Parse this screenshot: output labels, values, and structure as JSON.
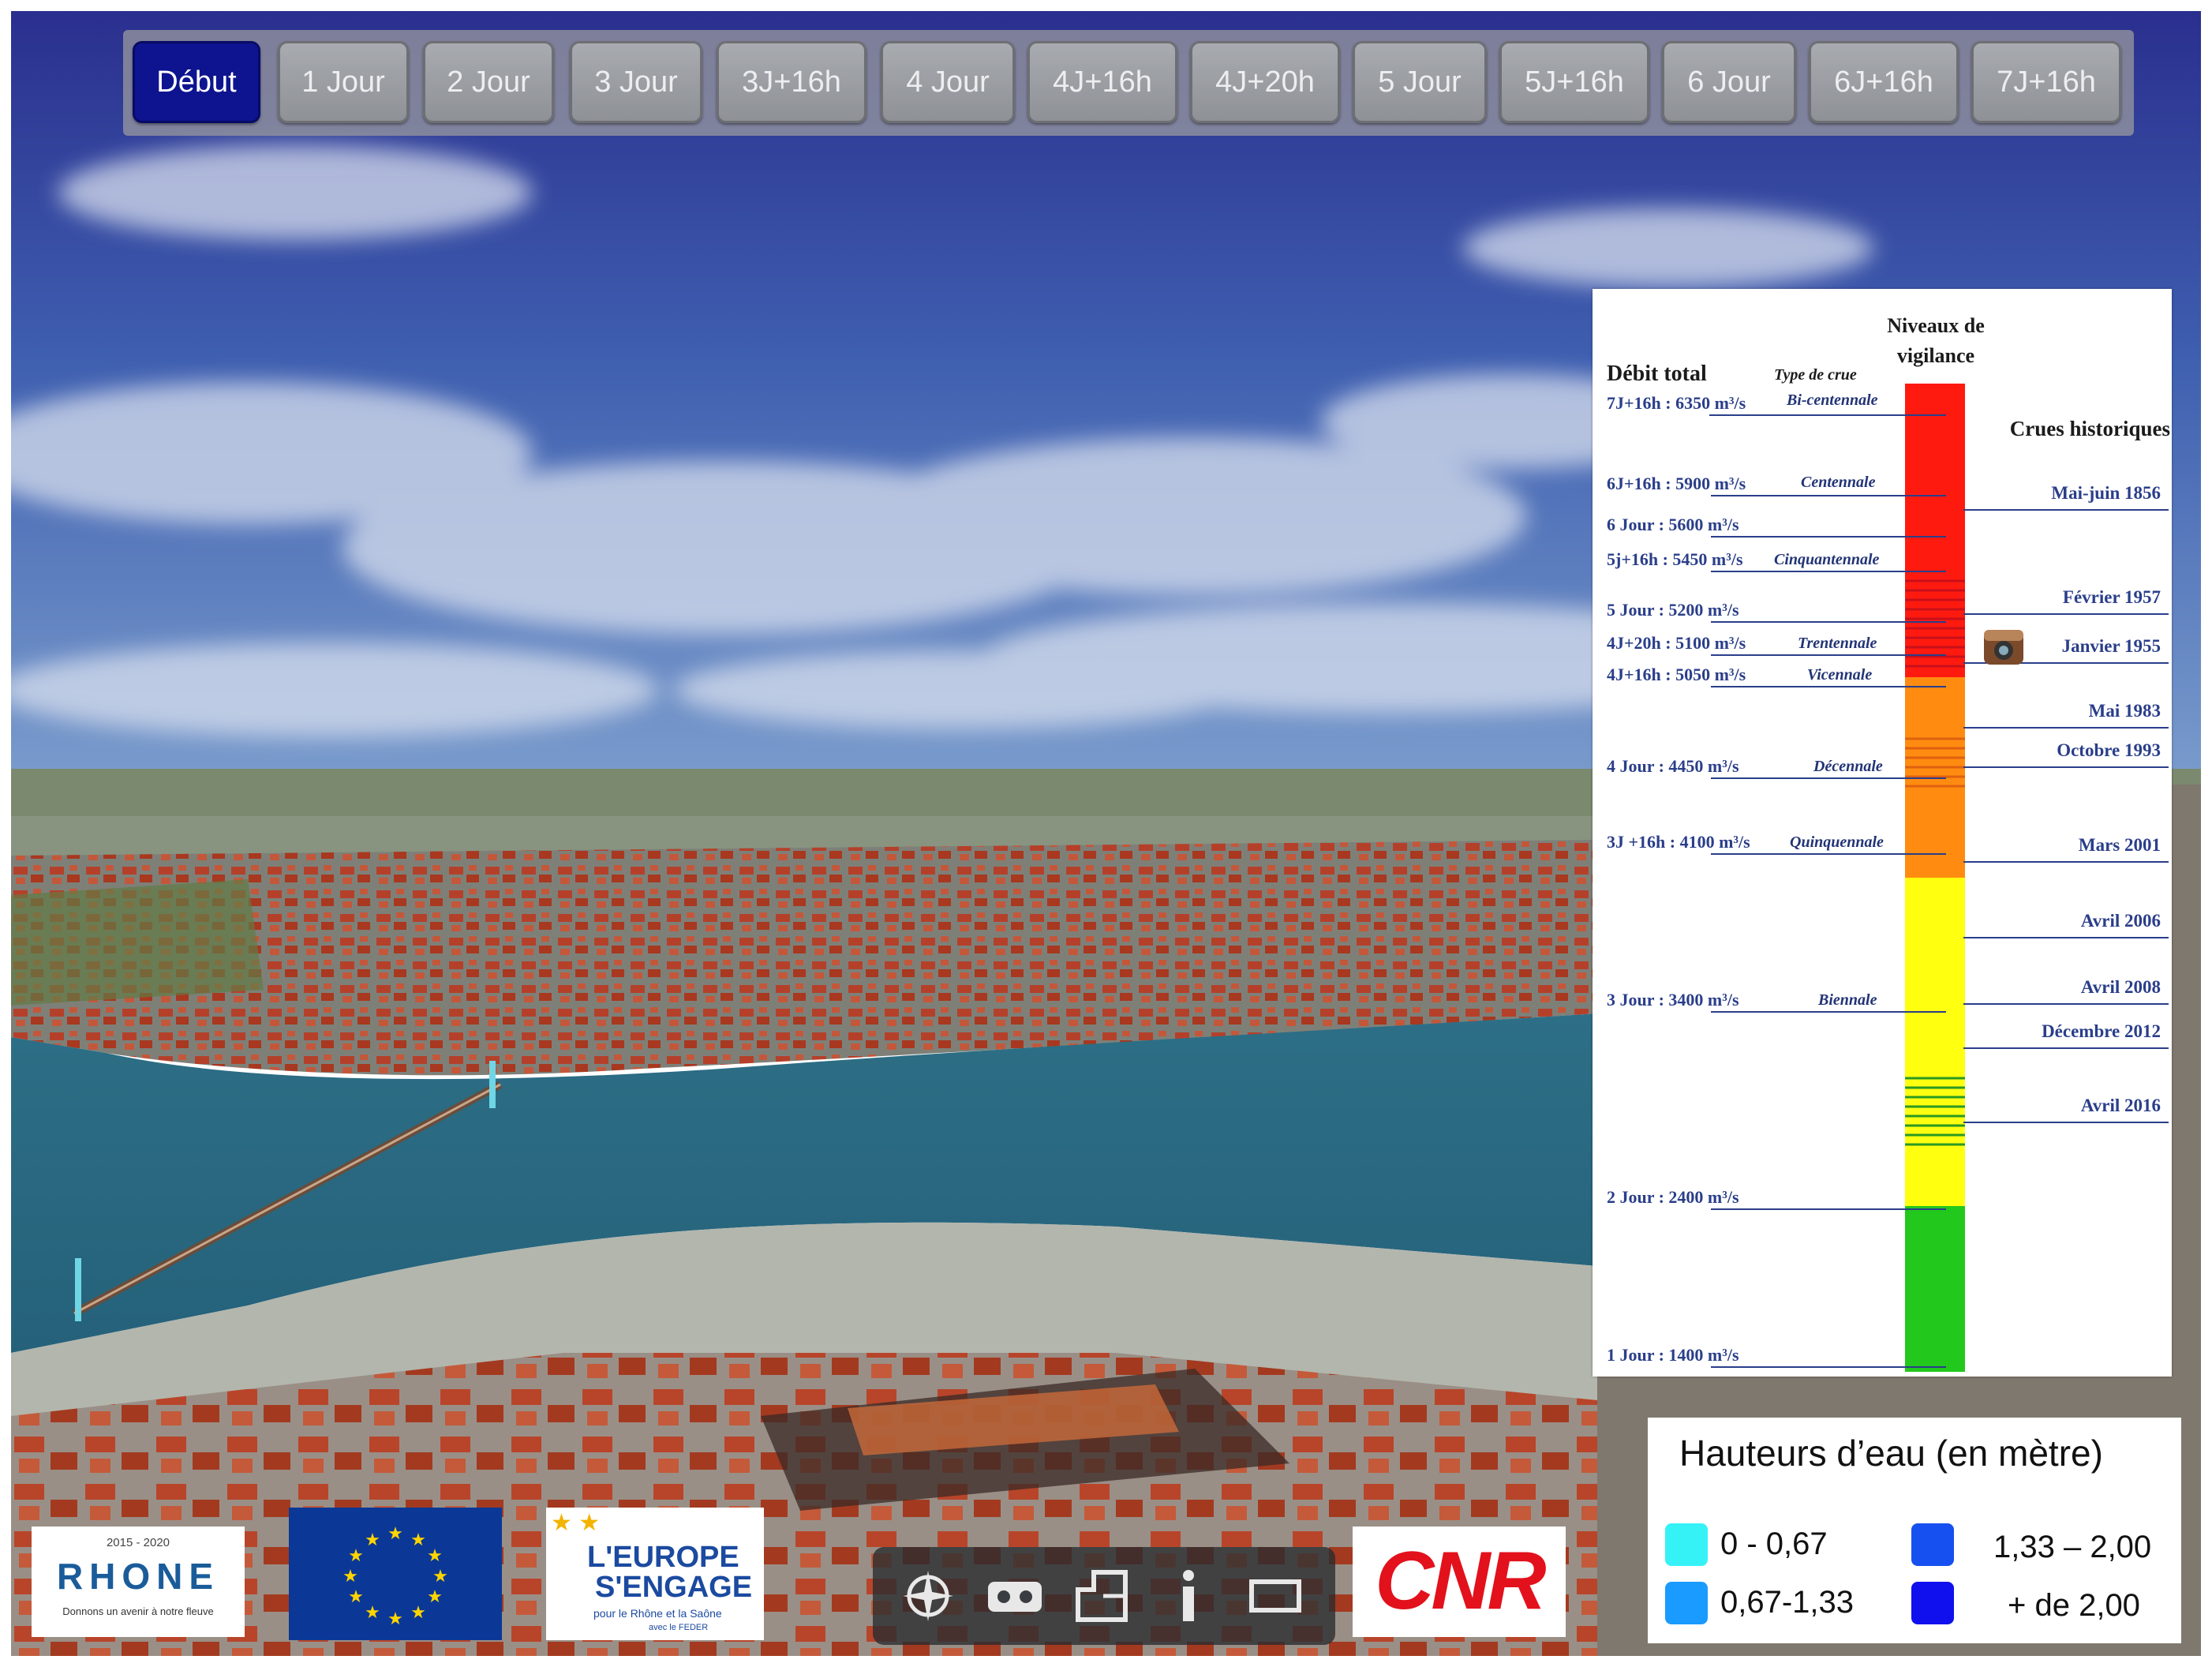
{
  "timeline": {
    "buttons": [
      {
        "label": "Début",
        "active": true
      },
      {
        "label": "1 Jour"
      },
      {
        "label": "2 Jour"
      },
      {
        "label": "3 Jour"
      },
      {
        "label": "3J+16h"
      },
      {
        "label": "4 Jour"
      },
      {
        "label": "4J+16h"
      },
      {
        "label": "4J+20h"
      },
      {
        "label": "5 Jour"
      },
      {
        "label": "5J+16h"
      },
      {
        "label": "6 Jour"
      },
      {
        "label": "6J+16h"
      },
      {
        "label": "7J+16h"
      }
    ]
  },
  "vigilance_panel": {
    "title_debit": "Débit total",
    "title_type": "Type de crue",
    "title_niveaux_line1": "Niveaux de",
    "title_niveaux_line2": "vigilance",
    "title_historiques": "Crues historiques",
    "debits": [
      {
        "label": "7J+16h : 6350 m³/s",
        "crue": "Bi-centennale"
      },
      {
        "label": "6J+16h : 5900 m³/s",
        "crue": "Centennale"
      },
      {
        "label": "6 Jour : 5600 m³/s",
        "crue": ""
      },
      {
        "label": "5j+16h : 5450 m³/s",
        "crue": "Cinquantennale"
      },
      {
        "label": "5 Jour : 5200 m³/s",
        "crue": ""
      },
      {
        "label": "4J+20h : 5100 m³/s",
        "crue": "Trentennale"
      },
      {
        "label": "4J+16h : 5050 m³/s",
        "crue": "Vicennale"
      },
      {
        "label": "4 Jour : 4450 m³/s",
        "crue": "Décennale"
      },
      {
        "label": "3J +16h : 4100 m³/s",
        "crue": "Quinquennale"
      },
      {
        "label": "3 Jour : 3400 m³/s",
        "crue": "Biennale"
      },
      {
        "label": "2 Jour : 2400 m³/s",
        "crue": ""
      },
      {
        "label": "1 Jour : 1400 m³/s",
        "crue": ""
      }
    ],
    "historiques": [
      "Mai-juin 1856",
      "Février 1957",
      "Janvier 1955",
      "Mai 1983",
      "Octobre 1993",
      "Mars 2001",
      "Avril 2006",
      "Avril 2008",
      "Décembre 2012",
      "Avril 2016"
    ],
    "colors": {
      "red": "#ff1a10",
      "orange": "#ff8c10",
      "yellow": "#ffff10",
      "green": "#22c81c",
      "line": "#2a3e8a"
    }
  },
  "legend": {
    "title": "Hauteurs d’eau (en mètre)",
    "items": [
      {
        "label": "0 - 0,67",
        "color": "#35f2f7"
      },
      {
        "label": "0,67-1,33",
        "color": "#1a9bff"
      },
      {
        "label": "1,33 – 2,00",
        "color": "#1650f0"
      },
      {
        "label": "+ de 2,00",
        "color": "#1010ee"
      }
    ]
  },
  "logos": {
    "rhone_years": "2015 - 2020",
    "rhone_name": "RHONE",
    "rhone_tagline": "Donnons un avenir à notre fleuve",
    "europe_line1": "L'EUROPE",
    "europe_line2": "S'ENGAGE",
    "europe_line3": "pour le Rhône et la Saône",
    "europe_line4": "avec le FEDER",
    "cnr": "CNR"
  },
  "toolbar": {
    "tools": [
      "compass-icon",
      "vr-headset-icon",
      "floor-plan-icon",
      "info-icon",
      "fullscreen-icon"
    ]
  }
}
